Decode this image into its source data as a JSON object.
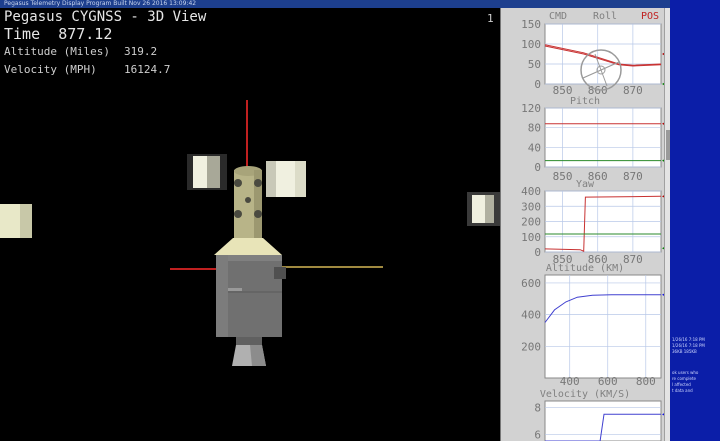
{
  "window": {
    "title": "Pegasus Telemetry Display Program  Built Nov 26 2016 13:09:42"
  },
  "view": {
    "title": "Pegasus CYGNSS - 3D View",
    "time_label": "Time",
    "time_value": "877.12",
    "altitude_label": "Altitude (Miles)",
    "altitude_value": "319.2",
    "velocity_label": "Velocity (MPH)",
    "velocity_value": "16124.7",
    "pane_number": "1"
  },
  "colors": {
    "cmd": "#808080",
    "pos": "#c02020",
    "trace_red": "#c83232",
    "trace_green": "#2a8a2a",
    "trace_blue": "#4040d0",
    "marker_red": "#b00000",
    "marker_green": "#008000",
    "marker_blue": "#1010e0"
  },
  "charts": {
    "roll": {
      "title": "Roll",
      "left_label": "CMD",
      "right_label": "POS",
      "y_ticks": [
        "150",
        "100",
        "50",
        "0"
      ],
      "x_ticks": [
        "850",
        "860",
        "870"
      ]
    },
    "pitch": {
      "title": "Pitch",
      "y_ticks": [
        "120",
        "80",
        "40",
        "0"
      ],
      "x_ticks": [
        "850",
        "860",
        "870"
      ]
    },
    "yaw": {
      "title": "Yaw",
      "y_ticks": [
        "400",
        "300",
        "200",
        "100",
        "0"
      ],
      "x_ticks": [
        "850",
        "860",
        "870"
      ]
    },
    "altitude": {
      "title": "Altitude (KM)",
      "y_ticks": [
        "600",
        "400",
        "200"
      ],
      "x_ticks": [
        "400",
        "600",
        "800"
      ]
    },
    "velocity": {
      "title": "Velocity (KM/S)",
      "y_ticks": [
        "8",
        "6"
      ]
    }
  },
  "chart_data": [
    {
      "type": "line",
      "title": "Roll",
      "xlim": [
        845,
        878
      ],
      "ylim": [
        0,
        150
      ],
      "series": [
        {
          "name": "CMD",
          "x": [
            845,
            856,
            866,
            870,
            878
          ],
          "y": [
            95,
            75,
            48,
            45,
            48
          ]
        },
        {
          "name": "POS",
          "x": [
            845,
            856,
            866,
            870,
            878
          ],
          "y": [
            98,
            78,
            50,
            47,
            50
          ]
        }
      ]
    },
    {
      "type": "line",
      "title": "Pitch",
      "xlim": [
        845,
        878
      ],
      "ylim": [
        0,
        120
      ],
      "series": [
        {
          "x": [
            845,
            878
          ],
          "y": [
            88,
            88
          ]
        },
        {
          "x": [
            845,
            878
          ],
          "y": [
            13,
            13
          ]
        }
      ]
    },
    {
      "type": "line",
      "title": "Yaw",
      "xlim": [
        845,
        878
      ],
      "ylim": [
        0,
        400
      ],
      "series": [
        {
          "x": [
            845,
            855,
            856,
            856.5,
            878
          ],
          "y": [
            20,
            15,
            5,
            360,
            365
          ]
        },
        {
          "x": [
            845,
            878
          ],
          "y": [
            118,
            118
          ]
        }
      ]
    },
    {
      "type": "line",
      "title": "Altitude (KM)",
      "xlim": [
        270,
        880
      ],
      "ylim": [
        0,
        650
      ],
      "series": [
        {
          "x": [
            270,
            320,
            380,
            440,
            520,
            620,
            720,
            880
          ],
          "y": [
            350,
            430,
            480,
            510,
            522,
            525,
            525,
            525
          ]
        }
      ]
    },
    {
      "type": "line",
      "title": "Velocity (KM/S)",
      "xlim": [
        270,
        880
      ],
      "ylim": [
        5.5,
        8.5
      ],
      "series": [
        {
          "x": [
            270,
            560,
            580,
            880
          ],
          "y": [
            5.5,
            5.5,
            7.5,
            7.5
          ]
        }
      ]
    }
  ],
  "desktop": {
    "text_lines": [
      "1/26/16 7:18 PM",
      "1/26/16 7:18 PM",
      "36KB  185KB",
      "ok users who",
      "re complete",
      "l affected",
      "t data and"
    ]
  }
}
